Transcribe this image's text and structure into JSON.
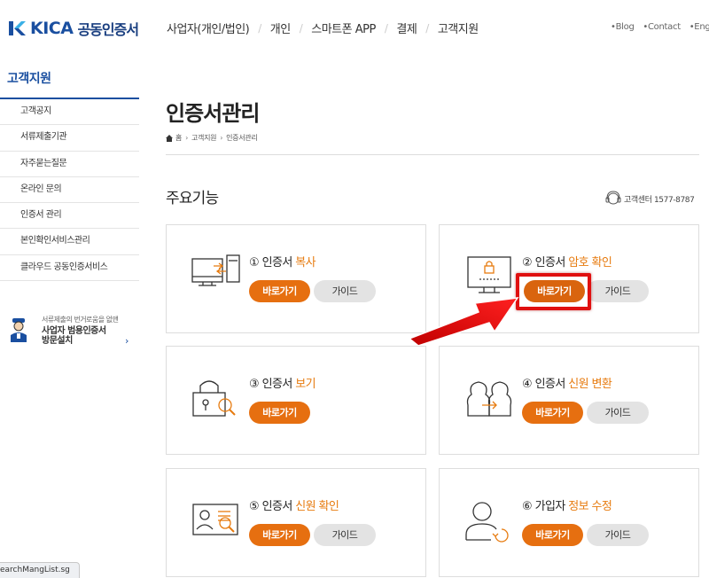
{
  "header": {
    "logo_text": "KICA",
    "logo_sub": "공동인증서",
    "nav": [
      "사업자(개인/법인)",
      "개인",
      "스마트폰 APP",
      "결제",
      "고객지원"
    ],
    "util_links": [
      "•Blog",
      "•Contact",
      "•English"
    ]
  },
  "sidebar": {
    "title": "고객지원",
    "items": [
      {
        "label": "고객공지"
      },
      {
        "label": "서류제출기관"
      },
      {
        "label": "자주묻는질문"
      },
      {
        "label": "온라인 문의"
      },
      {
        "label": "인증서 관리"
      },
      {
        "label": "본인확인서비스관리"
      },
      {
        "label": "클라우드 공동인증서비스"
      }
    ],
    "banner": {
      "small": "서류제출의 번거로움을 없앤",
      "line1": "사업자 범용인증서",
      "line2": "방문설치",
      "arrow": "›"
    }
  },
  "main": {
    "page_title": "인증서관리",
    "breadcrumb": [
      "홈",
      "고객지원",
      "인증서관리"
    ],
    "breadcrumb_sep": "›",
    "section_title": "주요기능",
    "contact": "고객센터 1577-8787",
    "cards": [
      {
        "num": "①",
        "prefix": "인증서 ",
        "highlight": "복사",
        "go": "바로가기",
        "guide": "가이드",
        "icon": "copy-cert-icon"
      },
      {
        "num": "②",
        "prefix": "인증서 ",
        "highlight": "암호 확인",
        "go": "바로가기",
        "guide": "가이드",
        "icon": "password-check-icon"
      },
      {
        "num": "③",
        "prefix": "인증서 ",
        "highlight": "보기",
        "go": "바로가기",
        "guide": "",
        "icon": "view-cert-icon"
      },
      {
        "num": "④",
        "prefix": "인증서 ",
        "highlight": "신원 변환",
        "go": "바로가기",
        "guide": "가이드",
        "icon": "identity-convert-icon"
      },
      {
        "num": "⑤",
        "prefix": "인증서 ",
        "highlight": "신원 확인",
        "go": "바로가기",
        "guide": "가이드",
        "icon": "identity-verify-icon"
      },
      {
        "num": "⑥",
        "prefix": "가입자 ",
        "highlight": "정보 수정",
        "go": "바로가기",
        "guide": "가이드",
        "icon": "edit-info-icon"
      }
    ]
  },
  "status_bar": "earchMangList.sg",
  "colors": {
    "brand": "#1a4fa0",
    "accent": "#e66f10",
    "highlight_text": "#e77b0f",
    "annotation": "#e01010"
  }
}
